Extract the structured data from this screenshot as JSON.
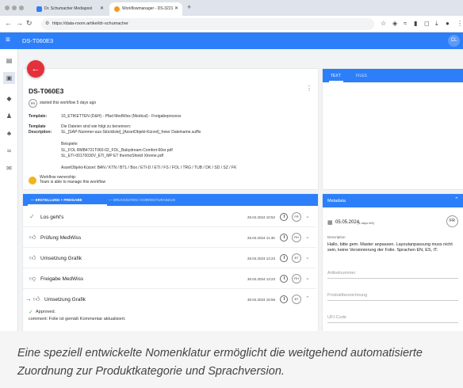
{
  "browser": {
    "tabs": [
      {
        "label": "Dr. Schumacher Mediapool"
      },
      {
        "label": "Workflowmanager - DS-3221"
      }
    ],
    "url": "https://data-room.artikel/dr-schumacher"
  },
  "app": {
    "title": "DS-T060E3",
    "user_initials": "CL"
  },
  "workflow": {
    "title": "DS-T060E3",
    "started_by": "FR",
    "started_text": "started this workflow 5 days ago",
    "template_label": "Template:",
    "template_value": "10_ETIKETTEN (D&H) - Pfad MedWiss (Medical) - Freigabeprozess",
    "template_desc_label_1": "Template",
    "template_desc_label_2": "Description:",
    "desc_line_1": "Die Dateien sind wie folgt zu benennen:",
    "desc_line_2": "SL_[SAP-Nummer-aus-Stückliste]_[AssetObjekt-Kürzel]_freier Dateiname.suffix",
    "example_label": "Beispiele:",
    "example_1": "SL_FOL RMB4721T060-02_FOL_Babydream-Comfort-60er.pdf",
    "example_2": "SL_ETI-00170030V_ETI_MP ET thermoShield Xtreme.pdf",
    "asset_codes": "AssetObjekt-Kürzel: BAN / KTN / BTL / Box / ETI-D / ETI / FS / FOL / TRG / TUB / DK / SD / SZ / FK",
    "ownership_1": "Workflow ownership:",
    "ownership_2": "Team is able to manage this workflow",
    "more_icon": "more-vert-icon"
  },
  "right_tabs": {
    "text": "TEXT",
    "files": "FILES"
  },
  "step_tabs": {
    "tab1": "ERSTELLUNG + FREIGABE",
    "tab2": "DRUCKDATEN / KORREKTURABZUG"
  },
  "steps": [
    {
      "label": "Los geht's",
      "date": "25.04.2024 10:52",
      "avatar": "FR",
      "icon": "check-icon"
    },
    {
      "label": "Prüfung MedWiss",
      "date": "25.04.2024 11:36",
      "avatar": "RH",
      "icon": "thumb-up-icon"
    },
    {
      "label": "Umsetzung Grafik",
      "date": "26.04.2024 14:23",
      "avatar": "BT",
      "icon": "thumb-up-icon"
    },
    {
      "label": "Freigabe MedWiss",
      "date": "30.04.2024 13:23",
      "avatar": "RH",
      "icon": "thumb-down-icon"
    },
    {
      "label": "Umsetzung Grafik",
      "date": "30.04.2024 15:56",
      "avatar": "BT",
      "icon": "thumb-up-icon"
    }
  ],
  "comment": {
    "status": "Approved.",
    "text": "comment: Folie ist gemäß Kommentar aktualisiert."
  },
  "metadata": {
    "title": "Metadata",
    "date": "05.05.2024",
    "days_left": "(4 days left)",
    "avatar": "FR",
    "desc_label": "Description",
    "desc_text": "Hallo, bitte gem. Master anpassen. Layoutanpassung muss nicht sein, keine Versionierung der Folie. Sprachen EN, ES, IT.",
    "field1": "Artikelnummer",
    "field2": "Produktbezeichnung",
    "field3": "UFI-Code"
  },
  "caption": "Eine speziell entwickelte Nomenklatur ermöglicht die weitgehend automatisierte Zuordnung zur Produktkategorie und Sprachversion.",
  "colors": {
    "accent": "#2d7ff9",
    "fab": "#e5303b",
    "avatar_yellow": "#f2b51b"
  }
}
